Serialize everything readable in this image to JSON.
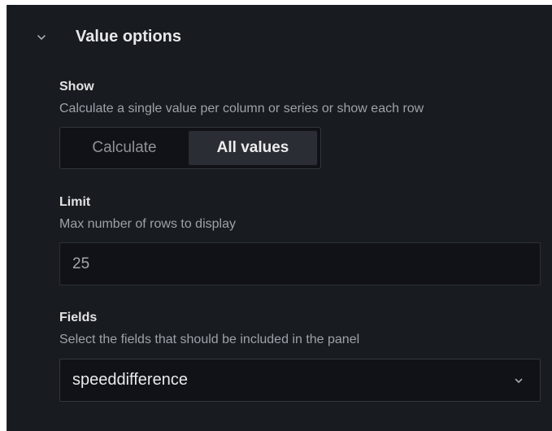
{
  "section": {
    "title": "Value options",
    "expanded": true,
    "chevron_icon": "chevron-down-icon"
  },
  "show": {
    "label": "Show",
    "description": "Calculate a single value per column or series or show each row",
    "options": [
      "Calculate",
      "All values"
    ],
    "selected": "All values"
  },
  "limit": {
    "label": "Limit",
    "description": "Max number of rows to display",
    "value": "25"
  },
  "fields": {
    "label": "Fields",
    "description": "Select the fields that should be included in the panel",
    "selected": "speeddifference",
    "chevron_icon": "chevron-down-icon"
  },
  "colors": {
    "panel_bg": "#181b1f",
    "input_bg": "#111217",
    "selected_bg": "#2a2d33",
    "text_primary": "#e2e3e5",
    "text_secondary": "#9ea2a9"
  }
}
